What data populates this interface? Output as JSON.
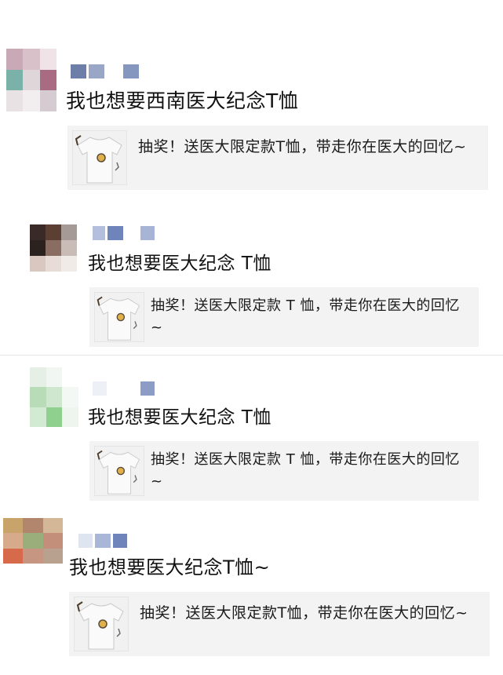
{
  "posts": [
    {
      "comment": "我也想要西南医大纪念T恤",
      "card_text": "抽奖！送医大限定款T恤，带走你在医大的回忆~",
      "avatar_colors": [
        "#c9a9b5",
        "#d9c1c9",
        "#f0e3e8",
        "#7ab1a9",
        "#dfd6da",
        "#a86b82",
        "#e9e2e4",
        "#f2eef0",
        "#d5cbd0"
      ],
      "name_colors": [
        "#6d7fa8",
        "#9aa6c6",
        "#ffffff",
        "#8596bf"
      ]
    },
    {
      "comment": "我也想要医大纪念 T恤",
      "card_text": "抽奖！送医大限定款 T 恤，带走你在医大的回忆 ~",
      "avatar_colors": [
        "#3a2a27",
        "#5c3f33",
        "#a69a96",
        "#2b211f",
        "#8a6d62",
        "#c9bcb6",
        "#d8c8c0",
        "#e8dcd6",
        "#f1ebe8"
      ],
      "name_colors": [
        "#b3bfdc",
        "#6f84bb",
        "#ffffff",
        "#a8b4d6"
      ]
    },
    {
      "comment": "我也想要医大纪念 T恤",
      "card_text": "抽奖！送医大限定款 T 恤，带走你在医大的回忆 ~",
      "avatar_colors": [
        "#e6efe6",
        "#f2f6f2",
        "#ffffff",
        "#b7dcb7",
        "#cfe6cf",
        "#f4f8f4",
        "#d2e9d2",
        "#8fd08f",
        "#eef5ee"
      ],
      "name_colors": [
        "#eef0f7",
        "#ffffff",
        "#ffffff",
        "#8d9cc6"
      ]
    },
    {
      "comment": "我也想要医大纪念T恤~",
      "card_text": "抽奖！送医大限定款T恤，带走你在医大的回忆~",
      "avatar_colors": [
        "#c9a46a",
        "#b2866c",
        "#d4b796",
        "#d8aa8c",
        "#9aae7c",
        "#c48f7a",
        "#d66a4b",
        "#c79683",
        "#b9a18f"
      ],
      "name_colors": [
        "#dfe4f1",
        "#aab6d8",
        "#6f84bb",
        "#ffffff"
      ]
    }
  ]
}
